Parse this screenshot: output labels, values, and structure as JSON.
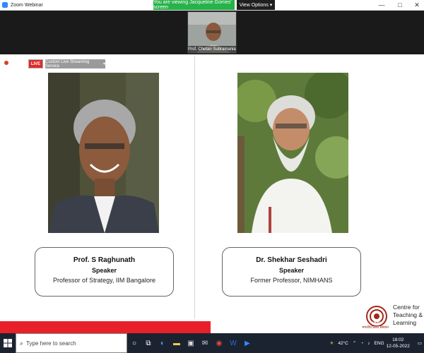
{
  "window": {
    "title": "Zoom Webinar",
    "viewing_banner": "You are viewing Jacqueline Gomes' screen",
    "view_options": "View Options",
    "controls": {
      "minimize": "—",
      "maximize": "□",
      "close": "✕"
    }
  },
  "video_thumb": {
    "name": "Prof. Chetan Subramanian"
  },
  "stream": {
    "live": "LIVE",
    "service": "Custom Live Streaming Service"
  },
  "speakers": [
    {
      "name": "Prof. S Raghunath",
      "role": "Speaker",
      "desc": "Professor of Strategy, IIM Bangalore"
    },
    {
      "name": "Dr. Shekhar Seshadri",
      "role": "Speaker",
      "desc": "Former Professor, NIMHANS"
    }
  ],
  "logo": {
    "mark": "IIMB",
    "line1": "Centre for",
    "line2": "Teaching &",
    "line3": "Learning",
    "hindi": "भारतीय प्रबंध संस्थान"
  },
  "taskbar": {
    "search_placeholder": "Type here to search",
    "weather": "42°C",
    "lang": "ENG",
    "time": "18:02",
    "date": "12-05-2022"
  },
  "colors": {
    "live_red": "#e02a2a",
    "zoom_blue": "#2d8cff",
    "banner_green": "#27b24a"
  }
}
